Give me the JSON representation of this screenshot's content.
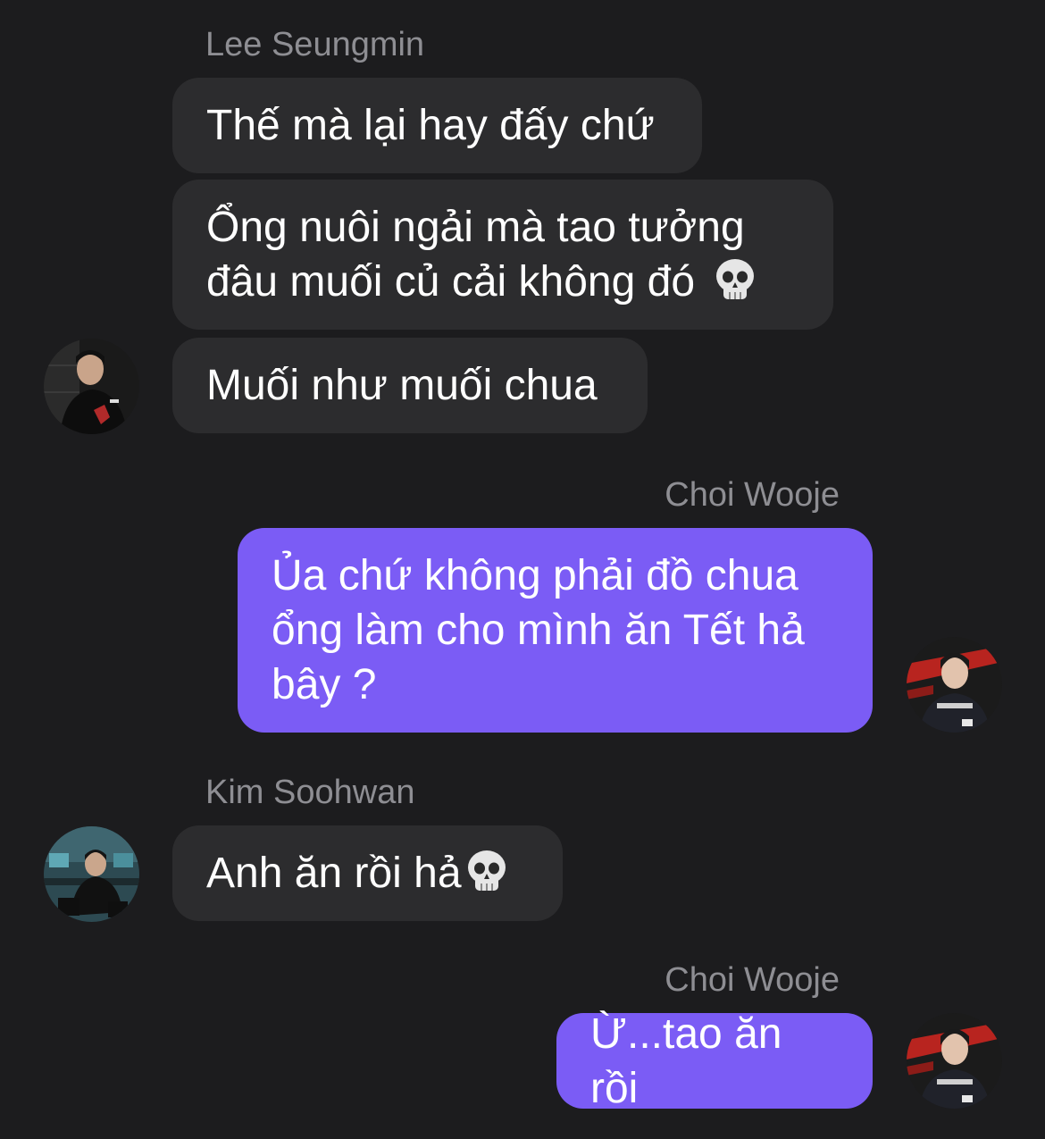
{
  "colors": {
    "background": "#1c1c1e",
    "incoming_bubble": "#2c2c2e",
    "outgoing_bubble": "#7b5cf5",
    "sender_name": "#8e8e93",
    "text": "#ffffff"
  },
  "messages": [
    {
      "sender": "Lee Seungmin",
      "direction": "incoming",
      "bubbles": [
        {
          "lines": [
            "Thế mà lại hay đấy chứ"
          ]
        },
        {
          "lines": [
            "Ổng nuôi ngải mà tao tưởng",
            "đâu muối củ cải không đó"
          ],
          "emoji": "skull-emoji"
        },
        {
          "lines": [
            "Muối như muối chua"
          ]
        }
      ],
      "avatar": "avatar-lee-seungmin"
    },
    {
      "sender": "Choi Wooje",
      "direction": "outgoing",
      "bubbles": [
        {
          "lines": [
            "Ủa chứ không phải đồ chua",
            "ổng làm cho mình ăn Tết hả",
            "bây ?"
          ]
        }
      ],
      "avatar": "avatar-choi-wooje"
    },
    {
      "sender": "Kim Soohwan",
      "direction": "incoming",
      "bubbles": [
        {
          "lines": [
            "Anh ăn rồi hả"
          ],
          "emoji": "skull-emoji"
        }
      ],
      "avatar": "avatar-kim-soohwan"
    },
    {
      "sender": "Choi Wooje",
      "direction": "outgoing",
      "bubbles": [
        {
          "lines": [
            "Ừ...tao ăn rồi"
          ]
        }
      ],
      "avatar": "avatar-choi-wooje"
    }
  ]
}
